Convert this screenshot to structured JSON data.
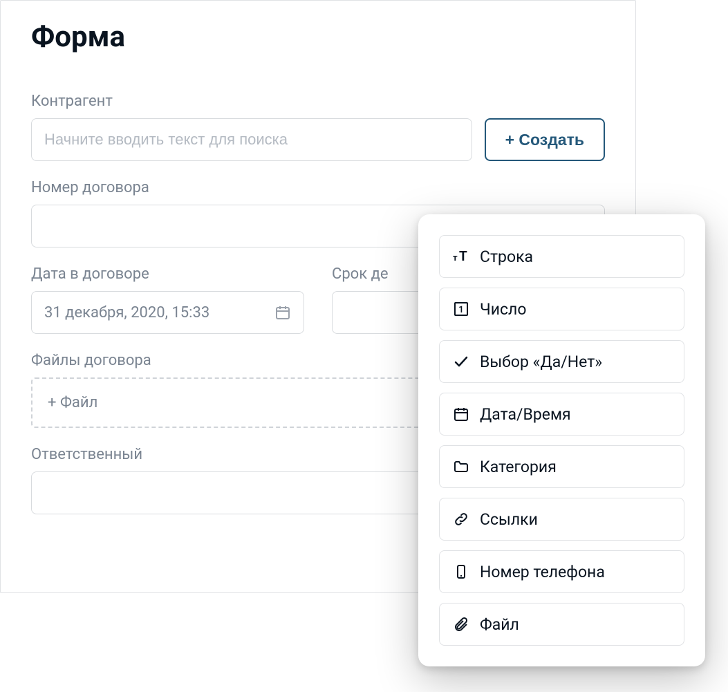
{
  "form": {
    "title": "Форма",
    "contractor": {
      "label": "Контрагент",
      "placeholder": "Начните вводить текст для поиска",
      "create_button": "+ Создать"
    },
    "contract_number": {
      "label": "Номер договора"
    },
    "contract_date": {
      "label": "Дата в договоре",
      "value": "31 декабря, 2020, 15:33"
    },
    "validity": {
      "label_partial": "Срок де"
    },
    "files": {
      "label": "Файлы договора",
      "add_label": "+ Файл"
    },
    "responsible": {
      "label": "Ответственный"
    }
  },
  "field_types": [
    {
      "icon": "text-size-icon",
      "label": "Строка"
    },
    {
      "icon": "number-icon",
      "label": "Число"
    },
    {
      "icon": "check-icon",
      "label": "Выбор «Да/Нет»"
    },
    {
      "icon": "calendar-icon",
      "label": "Дата/Время"
    },
    {
      "icon": "folder-icon",
      "label": "Категория"
    },
    {
      "icon": "link-icon",
      "label": "Ссылки"
    },
    {
      "icon": "phone-icon",
      "label": "Номер телефона"
    },
    {
      "icon": "attachment-icon",
      "label": "Файл"
    }
  ]
}
